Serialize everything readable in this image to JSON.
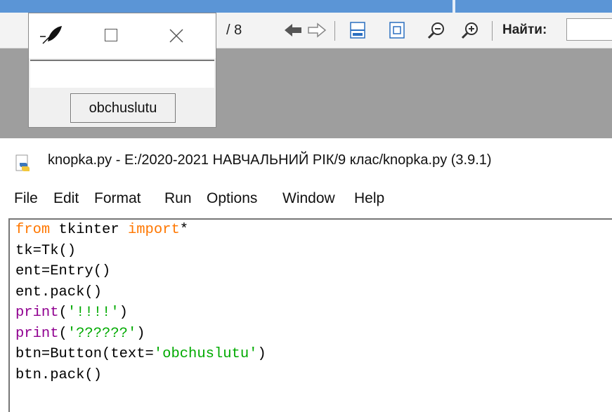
{
  "pdf_viewer": {
    "page_count": "/ 8",
    "find_label": "Найти:",
    "find_value": ""
  },
  "tk_window": {
    "entry_value": "",
    "button_label": "obchuslutu"
  },
  "idle_window": {
    "title": "knopka.py - E:/2020-2021 НАВЧАЛЬНИЙ РІК/9 клас/knopka.py (3.9.1)",
    "menu": [
      "File",
      "Edit",
      "Format",
      "Run",
      "Options",
      "Window",
      "Help"
    ],
    "code_lines": [
      [
        {
          "t": "from",
          "c": "kw"
        },
        {
          "t": " tkinter ",
          "c": ""
        },
        {
          "t": "import",
          "c": "kw"
        },
        {
          "t": "*",
          "c": ""
        }
      ],
      [
        {
          "t": "tk=Tk()",
          "c": ""
        }
      ],
      [
        {
          "t": "ent=Entry()",
          "c": ""
        }
      ],
      [
        {
          "t": "ent.pack()",
          "c": ""
        }
      ],
      [
        {
          "t": "print",
          "c": "bi"
        },
        {
          "t": "(",
          "c": ""
        },
        {
          "t": "'!!!!'",
          "c": "st"
        },
        {
          "t": ")",
          "c": ""
        }
      ],
      [
        {
          "t": "print",
          "c": "bi"
        },
        {
          "t": "(",
          "c": ""
        },
        {
          "t": "'??????'",
          "c": "st"
        },
        {
          "t": ")",
          "c": ""
        }
      ],
      [
        {
          "t": "btn=Button(text=",
          "c": ""
        },
        {
          "t": "'obchuslutu'",
          "c": "st"
        },
        {
          "t": ")",
          "c": ""
        }
      ],
      [
        {
          "t": "btn.pack()",
          "c": ""
        }
      ]
    ]
  },
  "colors": {
    "keyword": "#ff7700",
    "builtin": "#900090",
    "string": "#00aa00",
    "taskbar_blue": "#5b95d6",
    "viewer_gray": "#9e9e9e"
  },
  "icons": [
    "back-arrow-icon",
    "forward-arrow-icon",
    "fit-width-icon",
    "fit-page-icon",
    "zoom-out-icon",
    "zoom-in-icon",
    "tk-feather-icon",
    "python-file-icon"
  ]
}
